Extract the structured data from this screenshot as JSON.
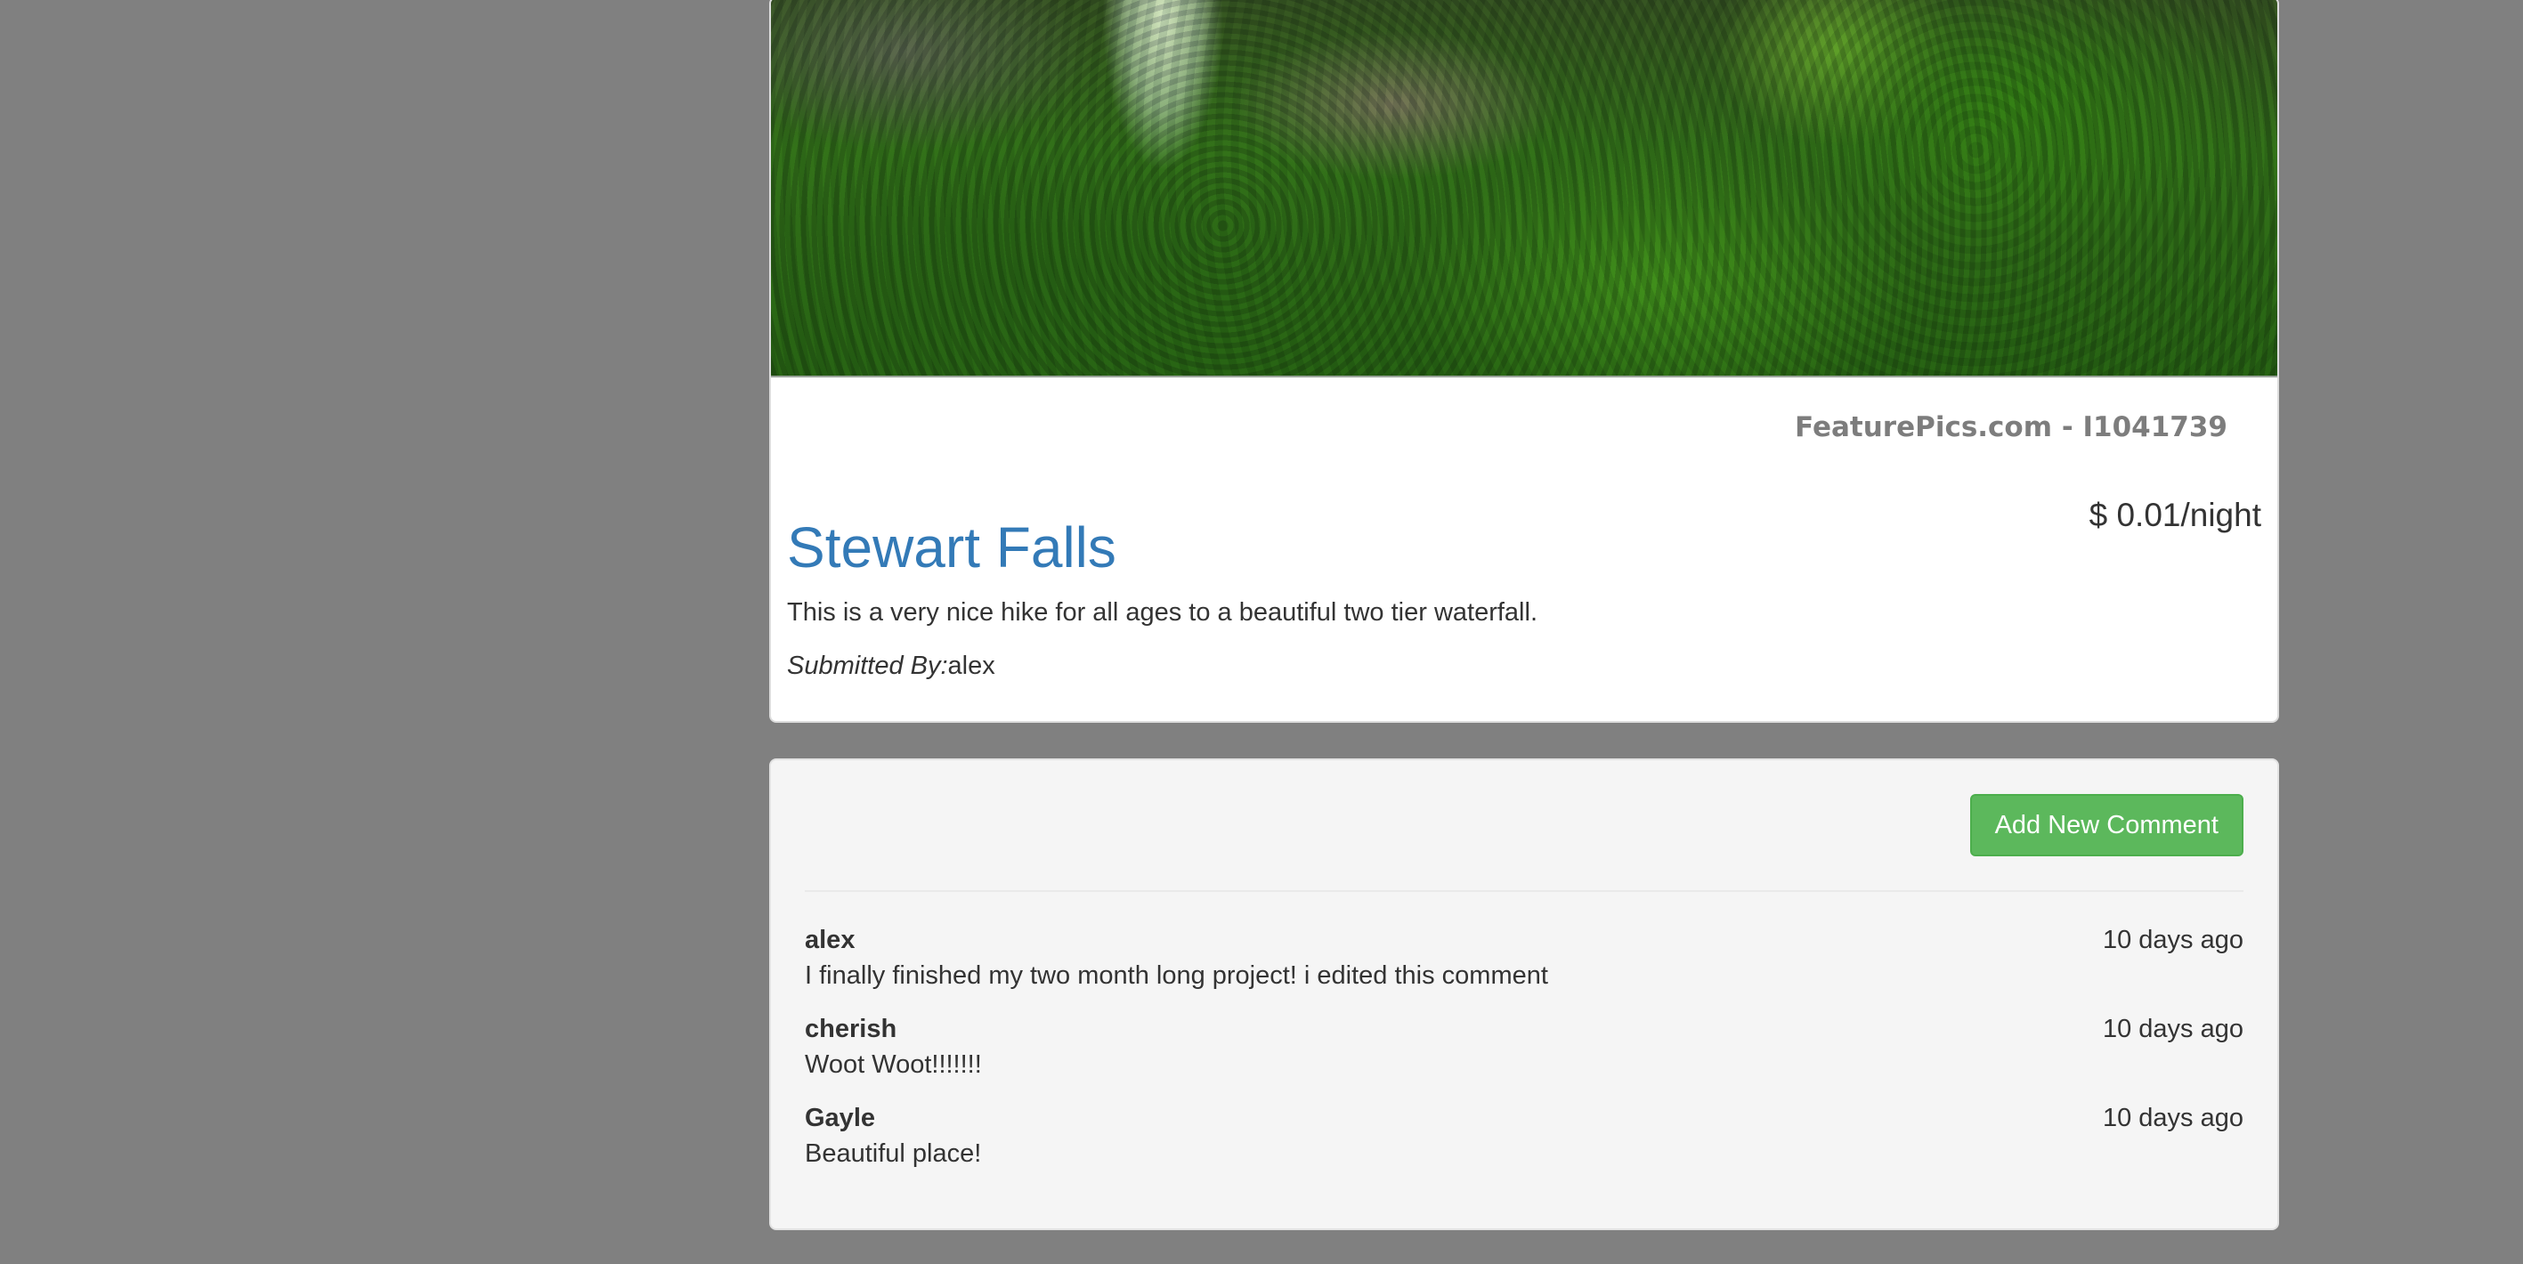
{
  "campground": {
    "image_watermark": "FeaturePics.com - I1041739",
    "title": "Stewart Falls",
    "price": "$ 0.01/night",
    "description": "This is a very nice hike for all ages to a beautiful two tier waterfall.",
    "submitted_label": "Submitted By:",
    "submitted_by": "alex"
  },
  "comments_section": {
    "add_button_label": "Add New Comment",
    "comments": [
      {
        "author": "alex",
        "time": "10 days ago",
        "text": "I finally finished my two month long project! i edited this comment"
      },
      {
        "author": "cherish",
        "time": "10 days ago",
        "text": "Woot Woot!!!!!!!"
      },
      {
        "author": "Gayle",
        "time": "10 days ago",
        "text": "Beautiful place!"
      }
    ]
  },
  "colors": {
    "page_background": "#808080",
    "title_link": "#337ab7",
    "success_button": "#5cb85c",
    "well_background": "#f5f5f5"
  }
}
